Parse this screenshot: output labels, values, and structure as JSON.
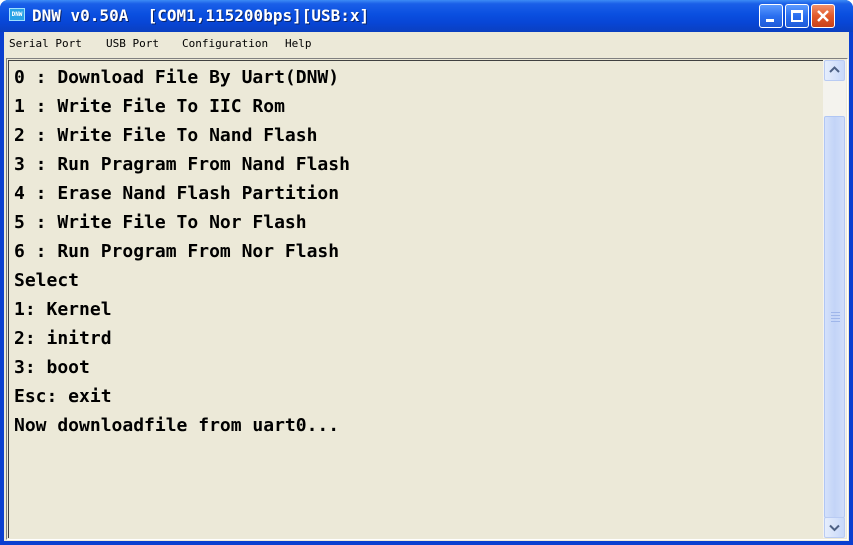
{
  "window": {
    "app_icon_text": "DNW",
    "title": "DNW v0.50A  [COM1,115200bps][USB:x]"
  },
  "menu": {
    "items": [
      "Serial Port",
      "USB Port",
      "Configuration",
      "Help"
    ]
  },
  "terminal": {
    "lines": [
      "0 : Download File By Uart(DNW)",
      "1 : Write File To IIC Rom",
      "2 : Write File To Nand Flash",
      "3 : Run Pragram From Nand Flash",
      "4 : Erase Nand Flash Partition",
      "5 : Write File To Nor Flash",
      "6 : Run Program From Nor Flash",
      "Select",
      "1: Kernel",
      "2: initrd",
      "3: boot",
      "Esc: exit",
      "Now downloadfile from uart0..."
    ]
  },
  "colors": {
    "titlebar": "#0a4fe0",
    "close_button": "#e25a2a",
    "client_background": "#ece9d8"
  }
}
